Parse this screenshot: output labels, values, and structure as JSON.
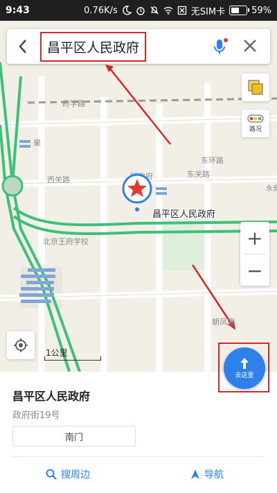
{
  "status_bar": {
    "time": "9:43",
    "network_speed": "0.76K/s",
    "sim_status": "无SIM卡",
    "battery": "59%",
    "battery_level": 0.59
  },
  "search": {
    "query": "昌平区人民政府",
    "back_icon": "chevron-left-icon",
    "mic_icon": "microphone-icon",
    "close_icon": "close-icon",
    "highlight_color": "#d9262b"
  },
  "map": {
    "labels": {
      "north_road": "府学路",
      "east_street": "东环路",
      "west_road": "西关路",
      "east_road": "东关路",
      "poi_label": "昌平区人民政府",
      "south_label": "朝凤庵",
      "right_edge_label": "永安路",
      "left_label": "北京王府学校",
      "small_label_1": "果",
      "small_label_2": "区政府"
    },
    "marker_icon": "red-star-marker-icon",
    "scale_label": "1公里",
    "colors": {
      "road_green": "#3fc07a",
      "marker_ring": "#2f80ea",
      "marker_star": "#e53935"
    }
  },
  "controls": {
    "layers_icon": "layers-icon",
    "traffic_label": "路况",
    "zoom_in": "+",
    "zoom_out": "−",
    "locate_icon": "locate-icon"
  },
  "route_button": {
    "label": "去这里",
    "icon": "route-arrow-icon",
    "color": "#2f80ea"
  },
  "place": {
    "name": "昌平区人民政府",
    "address": "政府街19号",
    "gate_chip": "南门"
  },
  "actions": {
    "nearby_label": "搜周边",
    "nearby_icon": "search-icon",
    "navigate_label": "导航",
    "navigate_icon": "navigate-arrow-icon"
  }
}
